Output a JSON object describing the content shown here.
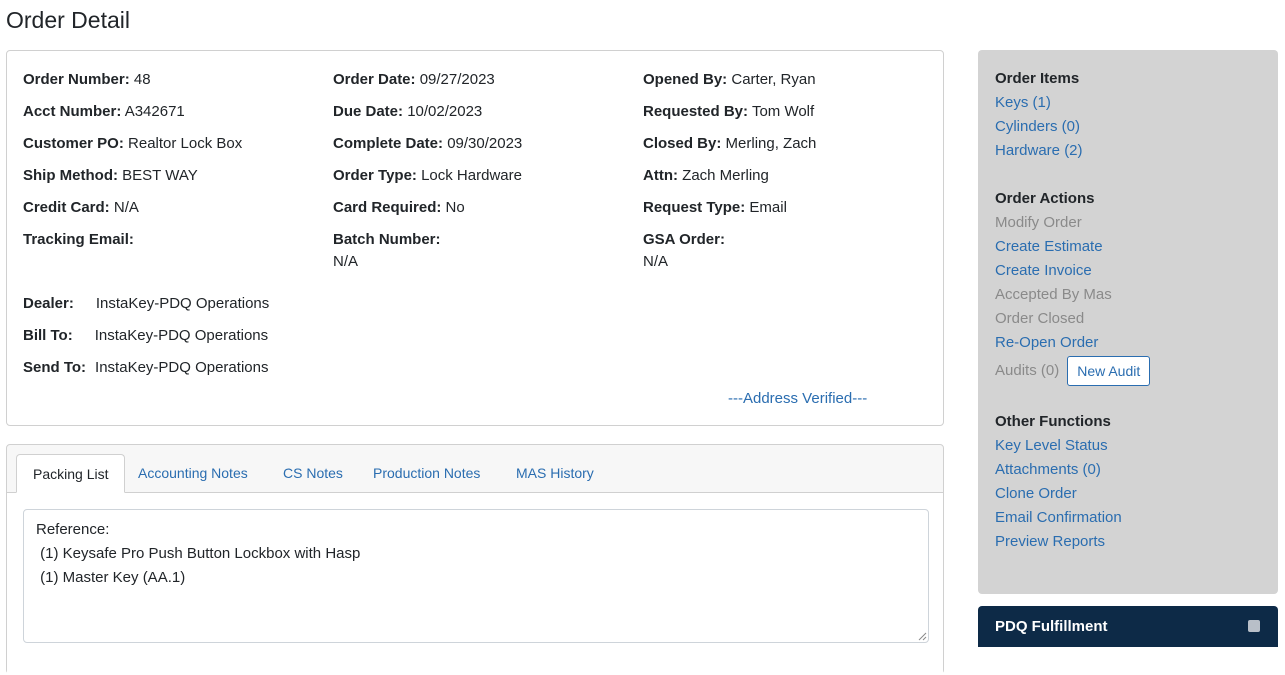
{
  "page": {
    "title": "Order Detail"
  },
  "order_info": {
    "col1": [
      {
        "label": "Order Number:",
        "value": "48"
      },
      {
        "label": "Acct Number:",
        "value": "A342671"
      },
      {
        "label": "Customer PO:",
        "value": "Realtor Lock Box"
      },
      {
        "label": "Ship Method:",
        "value": "BEST WAY"
      },
      {
        "label": "Credit Card:",
        "value": "N/A"
      },
      {
        "label": "Tracking Email:",
        "value": ""
      }
    ],
    "col2": [
      {
        "label": "Order Date:",
        "value": "09/27/2023"
      },
      {
        "label": "Due Date:",
        "value": "10/02/2023"
      },
      {
        "label": "Complete Date:",
        "value": "09/30/2023"
      },
      {
        "label": "Order Type:",
        "value": "Lock Hardware"
      },
      {
        "label": "Card Required:",
        "value": "No"
      },
      {
        "label": "Batch Number:",
        "value": "N/A"
      }
    ],
    "col3": [
      {
        "label": "Opened By:",
        "value": "Carter, Ryan"
      },
      {
        "label": "Requested By:",
        "value": "Tom Wolf"
      },
      {
        "label": "Closed By:",
        "value": "Merling, Zach"
      },
      {
        "label": "Attn:",
        "value": "Zach Merling"
      },
      {
        "label": "Request Type:",
        "value": "Email"
      },
      {
        "label": "GSA Order:",
        "value": "N/A"
      }
    ],
    "parties": [
      {
        "label": "Dealer:",
        "value": "InstaKey-PDQ Operations"
      },
      {
        "label": "Bill To:",
        "value": "InstaKey-PDQ Operations"
      },
      {
        "label": "Send To:",
        "value": "InstaKey-PDQ Operations"
      }
    ],
    "address_verified": "---Address Verified---"
  },
  "tabs": {
    "items": [
      {
        "label": "Packing List"
      },
      {
        "label": "Accounting Notes"
      },
      {
        "label": "CS Notes"
      },
      {
        "label": "Production Notes"
      },
      {
        "label": "MAS History"
      }
    ],
    "active": "Packing List",
    "notes_text": "Reference:\n (1) Keysafe Pro Push Button Lockbox with Hasp\n (1) Master Key (AA.1)"
  },
  "sidebar": {
    "order_items": {
      "heading": "Order Items",
      "items": [
        "Keys (1)",
        "Cylinders (0)",
        "Hardware (2)"
      ]
    },
    "order_actions": {
      "heading": "Order Actions",
      "items": [
        {
          "label": "Modify Order",
          "enabled": false
        },
        {
          "label": "Create Estimate",
          "enabled": true
        },
        {
          "label": "Create Invoice",
          "enabled": true
        },
        {
          "label": "Accepted By Mas",
          "enabled": false
        },
        {
          "label": "Order Closed",
          "enabled": false
        },
        {
          "label": "Re-Open Order",
          "enabled": true
        }
      ],
      "audits_label": "Audits (0)",
      "new_audit_label": "New Audit"
    },
    "other_functions": {
      "heading": "Other Functions",
      "items": [
        "Key Level Status",
        "Attachments (0)",
        "Clone Order",
        "Email Confirmation",
        "Preview Reports"
      ]
    }
  },
  "pdq": {
    "title": "PDQ Fulfillment"
  },
  "colors": {
    "link": "#2a6db0",
    "sidebar_bg": "#d3d3d3",
    "pdq_bg": "#0d2a47",
    "disabled_text": "#8a8a8a"
  }
}
